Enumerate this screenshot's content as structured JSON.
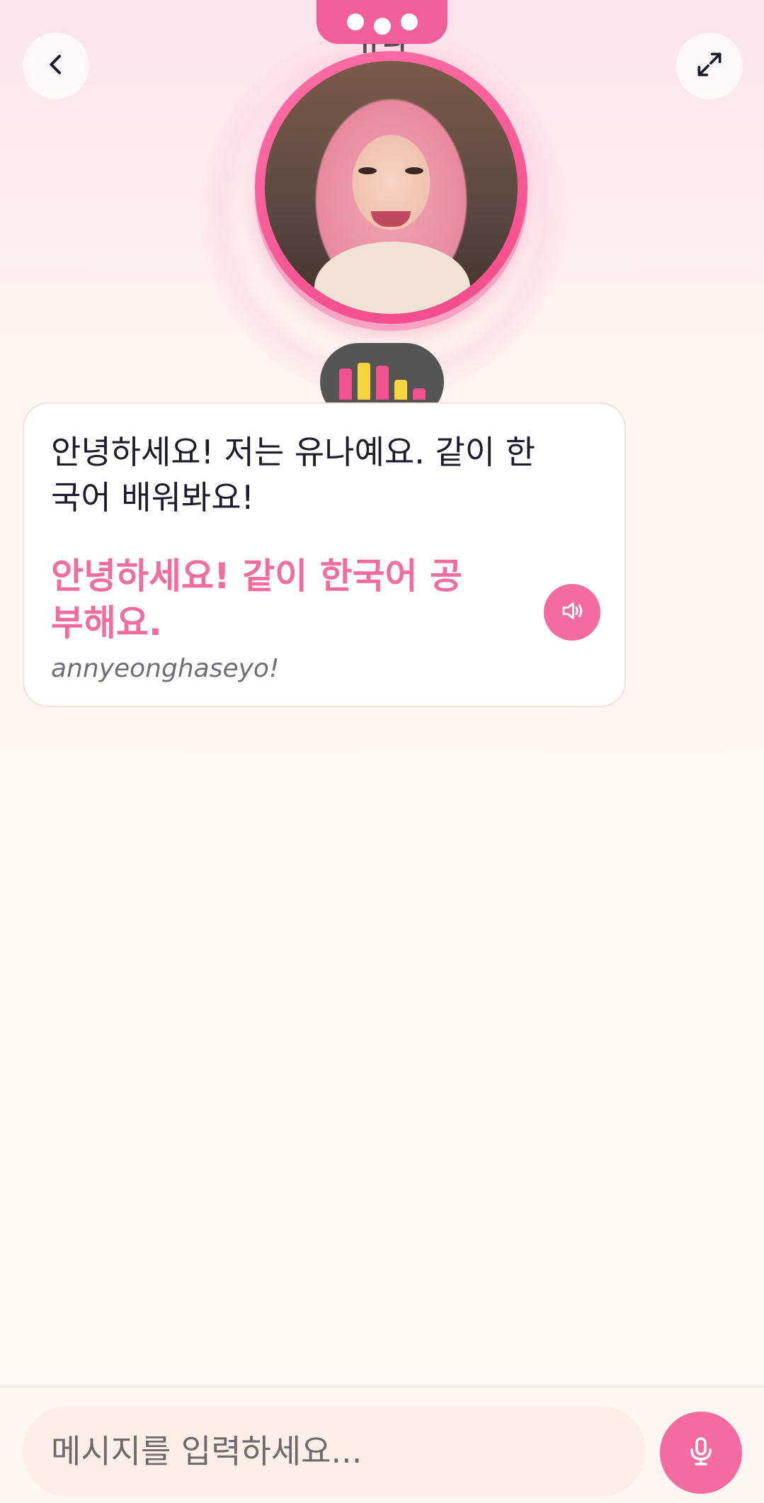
{
  "header": {
    "title": "유나",
    "back_icon": "chevron-left-icon",
    "expand_icon": "expand-icon"
  },
  "voice_indicator": {
    "bars": [
      {
        "level": 0.55,
        "color": "#f2508e"
      },
      {
        "level": 0.65,
        "color": "#f6d43c"
      },
      {
        "level": 0.6,
        "color": "#f2508e"
      },
      {
        "level": 0.35,
        "color": "#f6d43c"
      },
      {
        "level": 0.2,
        "color": "#f2508e"
      }
    ]
  },
  "message": {
    "text": "안녕하세요! 저는 유나예요. 같이 한국어 배워봐요!",
    "korean": "안녕하세요! 같이 한국어 공부해요.",
    "romanization": "annyeonghaseyo!",
    "speaker_icon": "speaker-icon"
  },
  "composer": {
    "placeholder": "메시지를 입력하세요...",
    "mic_icon": "microphone-icon"
  },
  "colors": {
    "accent": "#f46c9f",
    "korean_text": "#f26c9e"
  }
}
